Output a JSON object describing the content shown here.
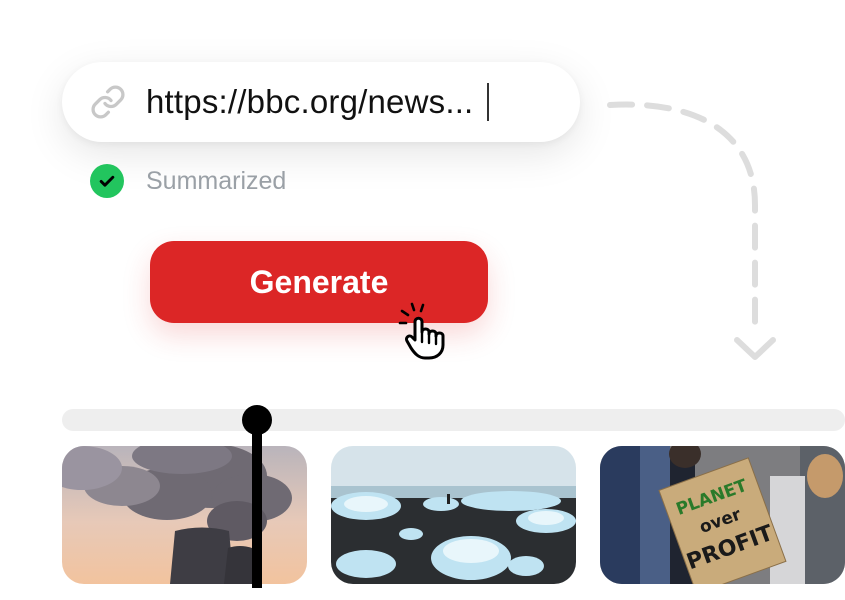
{
  "url_input": {
    "value": "https://bbc.org/news...",
    "icon": "link-icon"
  },
  "status": {
    "label": "Summarized",
    "icon": "check-circle-icon",
    "color": "#22c55e"
  },
  "generate_button": {
    "label": "Generate",
    "color": "#dc2626"
  },
  "timeline": {
    "playhead_progress": 0.25,
    "thumbnails": [
      {
        "subject": "power-plant-smoke"
      },
      {
        "subject": "melting-ice-beach"
      },
      {
        "subject": "climate-protest",
        "sign_text": [
          "PLANET",
          "over",
          "PROFIT"
        ]
      }
    ]
  }
}
